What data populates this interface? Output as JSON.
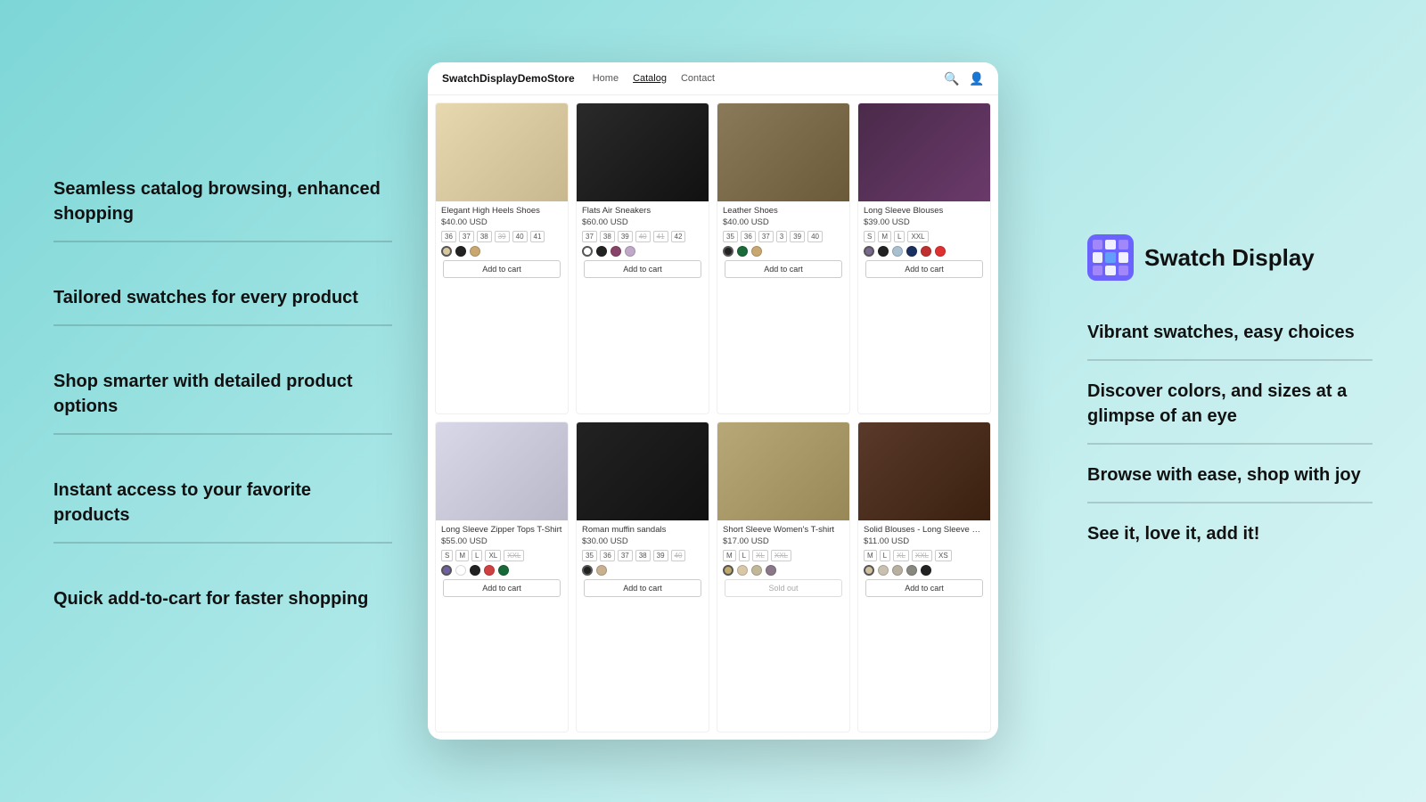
{
  "left_panel": {
    "features": [
      {
        "id": "seamless",
        "text": "Seamless catalog browsing, enhanced shopping"
      },
      {
        "id": "tailored",
        "text": "Tailored swatches for every product"
      },
      {
        "id": "smarter",
        "text": "Shop smarter with detailed product options"
      },
      {
        "id": "instant",
        "text": "Instant access to your favorite products"
      },
      {
        "id": "quickcart",
        "text": "Quick add-to-cart for faster shopping"
      }
    ]
  },
  "right_panel": {
    "brand": {
      "logo_alt": "Swatch Display logo",
      "title": "Swatch Display"
    },
    "features": [
      {
        "id": "vibrant",
        "text": "Vibrant swatches, easy choices"
      },
      {
        "id": "discover",
        "text": "Discover colors, and sizes at a glimpse of an eye"
      },
      {
        "id": "browse",
        "text": "Browse with ease, shop with joy"
      },
      {
        "id": "seeit",
        "text": "See it, love it, add it!"
      }
    ]
  },
  "store": {
    "brand": "SwatchDisplayDemoStore",
    "nav": [
      {
        "label": "Home",
        "active": false
      },
      {
        "label": "Catalog",
        "active": true
      },
      {
        "label": "Contact",
        "active": false
      }
    ]
  },
  "products": [
    {
      "id": "p1",
      "name": "Elegant High Heels Shoes",
      "price": "$40.00 USD",
      "sizes": [
        "36",
        "37",
        "38",
        "39",
        "40",
        "41"
      ],
      "strike_sizes": [
        "39"
      ],
      "colors": [
        "#d8c8a0",
        "#222222",
        "#c8a870"
      ],
      "img_style": "shoe-heel",
      "has_cart": true
    },
    {
      "id": "p2",
      "name": "Flats Air Sneakers",
      "price": "$60.00 USD",
      "sizes": [
        "37",
        "38",
        "39",
        "40",
        "41",
        "42"
      ],
      "strike_sizes": [
        "40",
        "41"
      ],
      "colors": [
        "#ffffff",
        "#222222",
        "#884468",
        "#c0a8c8"
      ],
      "img_style": "shoe-sneaker",
      "has_cart": true
    },
    {
      "id": "p3",
      "name": "Leather Shoes",
      "price": "$40.00 USD",
      "sizes": [
        "35",
        "36",
        "37",
        "3",
        "39",
        "40"
      ],
      "strike_sizes": [],
      "colors": [
        "#222222",
        "#1a6a3a",
        "#c8a870"
      ],
      "img_style": "shoe-loafer",
      "has_cart": true
    },
    {
      "id": "p4",
      "name": "Long Sleeve Blouses",
      "price": "$39.00 USD",
      "sizes": [
        "S",
        "M",
        "L",
        "XXL"
      ],
      "strike_sizes": [],
      "colors": [
        "#7a6890",
        "#222222",
        "#a8c0d0",
        "#1a3060",
        "#c03030",
        "#e03030"
      ],
      "img_style": "blouse-purple",
      "has_cart": true
    },
    {
      "id": "p5",
      "name": "Long Sleeve Zipper Tops T-Shirt",
      "price": "$55.00 USD",
      "sizes": [
        "S",
        "M",
        "L",
        "XL",
        "XXL"
      ],
      "strike_sizes": [
        "XXL"
      ],
      "colors": [
        "#7060a0",
        "#ffffff",
        "#222222",
        "#d04040",
        "#186838"
      ],
      "img_style": "zipper-top",
      "has_cart": true
    },
    {
      "id": "p6",
      "name": "Roman muffin sandals",
      "price": "$30.00 USD",
      "sizes": [
        "35",
        "36",
        "37",
        "38",
        "39",
        "40"
      ],
      "strike_sizes": [
        "40"
      ],
      "colors": [
        "#222222",
        "#c8b090"
      ],
      "img_style": "sandal-black",
      "has_cart": true
    },
    {
      "id": "p7",
      "name": "Short Sleeve Women's T-shirt",
      "price": "$17.00 USD",
      "sizes": [
        "M",
        "L",
        "XL",
        "XXL"
      ],
      "strike_sizes": [
        "XL",
        "XXL"
      ],
      "colors": [
        "#c0a868",
        "#d8c8a8",
        "#c0b898",
        "#8a7888"
      ],
      "img_style": "tshirt-khaki",
      "sold_out": true,
      "has_cart": false
    },
    {
      "id": "p8",
      "name": "Solid Blouses - Long Sleeve Slim Basic T-shirt",
      "price": "$11.00 USD",
      "sizes": [
        "M",
        "L",
        "XL",
        "XXL",
        "XS"
      ],
      "strike_sizes": [
        "XL",
        "XXL"
      ],
      "colors": [
        "#d0c0a0",
        "#c8c0b0",
        "#b8b0a0",
        "#888880",
        "#222222"
      ],
      "img_style": "blouse-brown",
      "has_cart": true
    }
  ],
  "labels": {
    "add_to_cart": "Add to cart",
    "sold_out": "Sold out"
  }
}
